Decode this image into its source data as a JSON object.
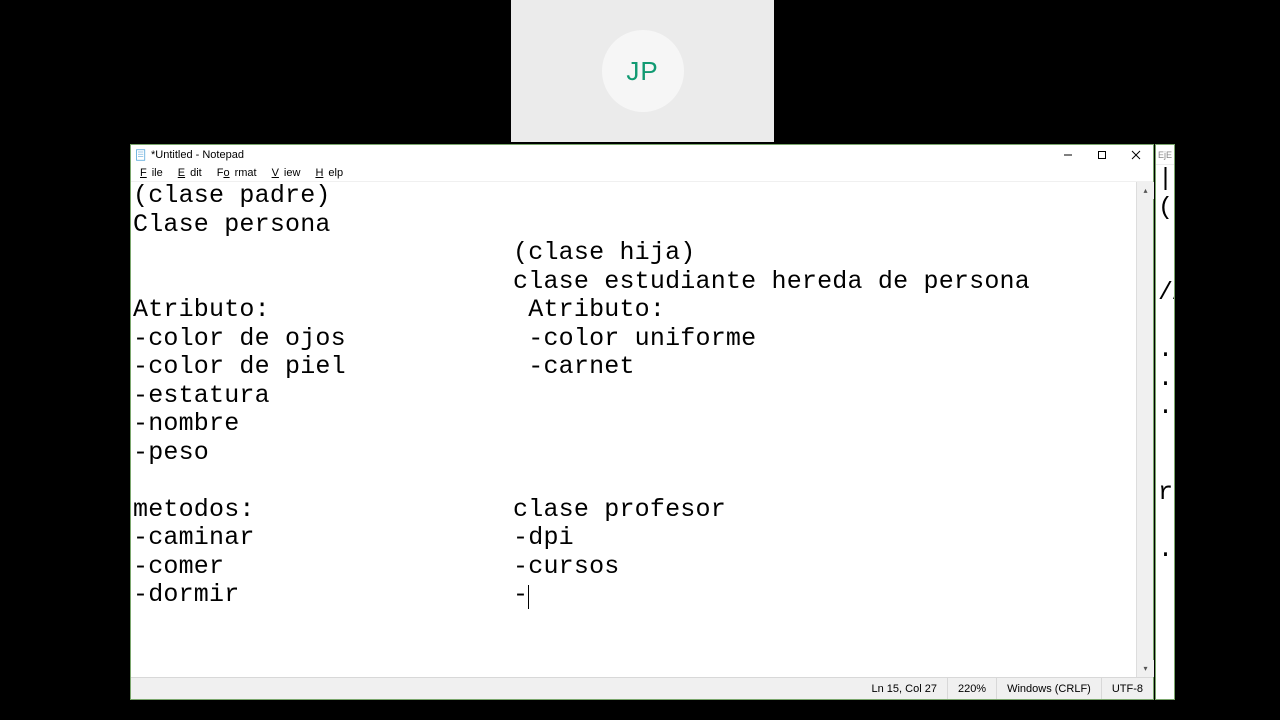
{
  "badge": {
    "initials": "JP"
  },
  "notepad": {
    "title": "*Untitled - Notepad",
    "menu": {
      "file": "File",
      "edit": "Edit",
      "format": "Format",
      "view": "View",
      "help": "Help"
    },
    "content": "(clase padre)\nClase persona\n                         (clase hija)\n                         clase estudiante hereda de persona\nAtributo:                 Atributo:\n-color de ojos            -color uniforme\n-color de piel            -carnet\n-estatura\n-nombre\n-peso\n\nmetodos:                 clase profesor\n-caminar                 -dpi\n-comer                   -cursos\n-dormir                  -",
    "status": {
      "position": "Ln 15, Col 27",
      "zoom": "220%",
      "line_ending": "Windows (CRLF)",
      "encoding": "UTF-8"
    }
  },
  "right_sliver": {
    "title_fragment": "EjE",
    "lines": "|\n(C\n\n\n/A\n\n..\n..\n..\n\n\nrr\n\n.."
  }
}
